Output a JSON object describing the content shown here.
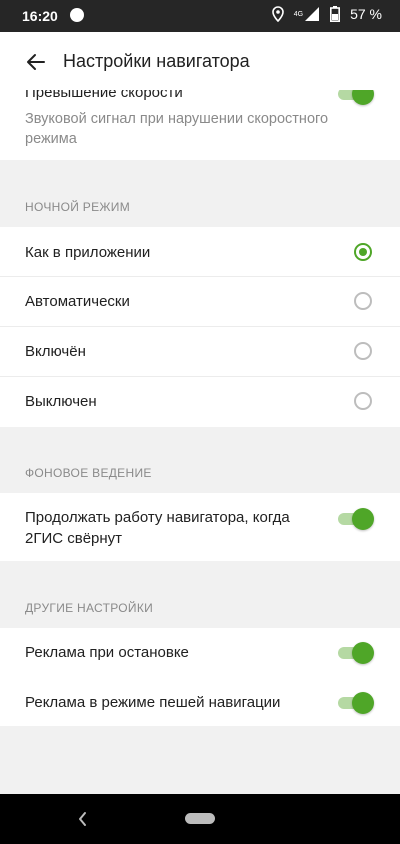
{
  "status_bar": {
    "time": "16:20",
    "network_label": "4G",
    "battery_text": "57 %",
    "icons": [
      "app-notification-icon",
      "location-icon",
      "signal-icon",
      "battery-icon"
    ]
  },
  "app_bar": {
    "title": "Настройки навигатора",
    "back_icon": "arrow-left-icon"
  },
  "speeding": {
    "title": "Превышение скорости",
    "subtitle": "Звуковой сигнал при нарушении скоростного режима",
    "enabled": true
  },
  "night_mode": {
    "header": "НОЧНОЙ РЕЖИМ",
    "options": [
      {
        "label": "Как в приложении",
        "selected": true
      },
      {
        "label": "Автоматически",
        "selected": false
      },
      {
        "label": "Включён",
        "selected": false
      },
      {
        "label": "Выключен",
        "selected": false
      }
    ]
  },
  "background": {
    "header": "ФОНОВОЕ ВЕДЕНИЕ",
    "items": [
      {
        "label": "Продолжать работу навигатора, когда 2ГИС свёрнут",
        "enabled": true
      }
    ]
  },
  "other": {
    "header": "ДРУГИЕ НАСТРОЙКИ",
    "items": [
      {
        "label": "Реклама при остановке",
        "enabled": true
      },
      {
        "label": "Реклама в режиме пешей навигации",
        "enabled": true
      }
    ]
  },
  "colors": {
    "accent": "#4fa628",
    "accent_light": "#b5d9a3",
    "background": "#f1f1f1",
    "status_bar": "#262626"
  }
}
